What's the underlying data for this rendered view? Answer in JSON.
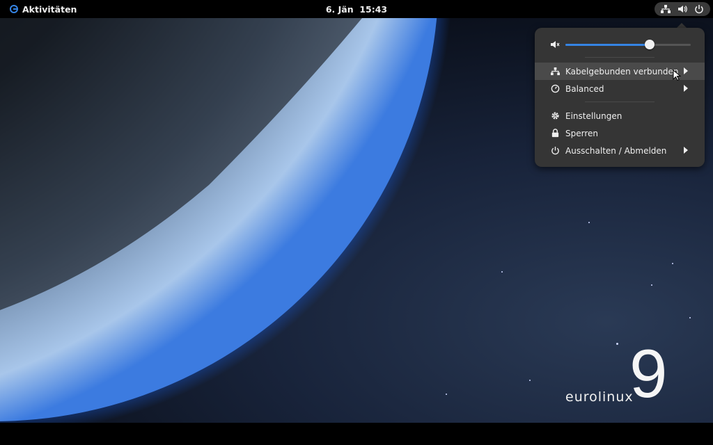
{
  "topbar": {
    "activities_label": "Aktivitäten",
    "clock": "6. Jän  15:43"
  },
  "tray": {
    "icons": [
      "network-wired-icon",
      "volume-icon",
      "power-icon"
    ]
  },
  "menu": {
    "volume_level": 0.67,
    "items": [
      {
        "label": "Kabelgebunden verbunden",
        "icon": "network-wired-icon",
        "submenu": true
      },
      {
        "label": "Balanced",
        "icon": "power-profile-icon",
        "submenu": true
      },
      {
        "label": "Einstellungen",
        "icon": "gear-icon",
        "submenu": false
      },
      {
        "label": "Sperren",
        "icon": "lock-icon",
        "submenu": false
      },
      {
        "label": "Ausschalten / Abmelden",
        "icon": "power-icon",
        "submenu": true
      }
    ]
  },
  "wallpaper": {
    "logo_text": "eurolinux",
    "logo_number": "9"
  },
  "colors": {
    "accent": "#3584e4",
    "menu_bg": "#353535",
    "topbar_bg": "#000000"
  }
}
